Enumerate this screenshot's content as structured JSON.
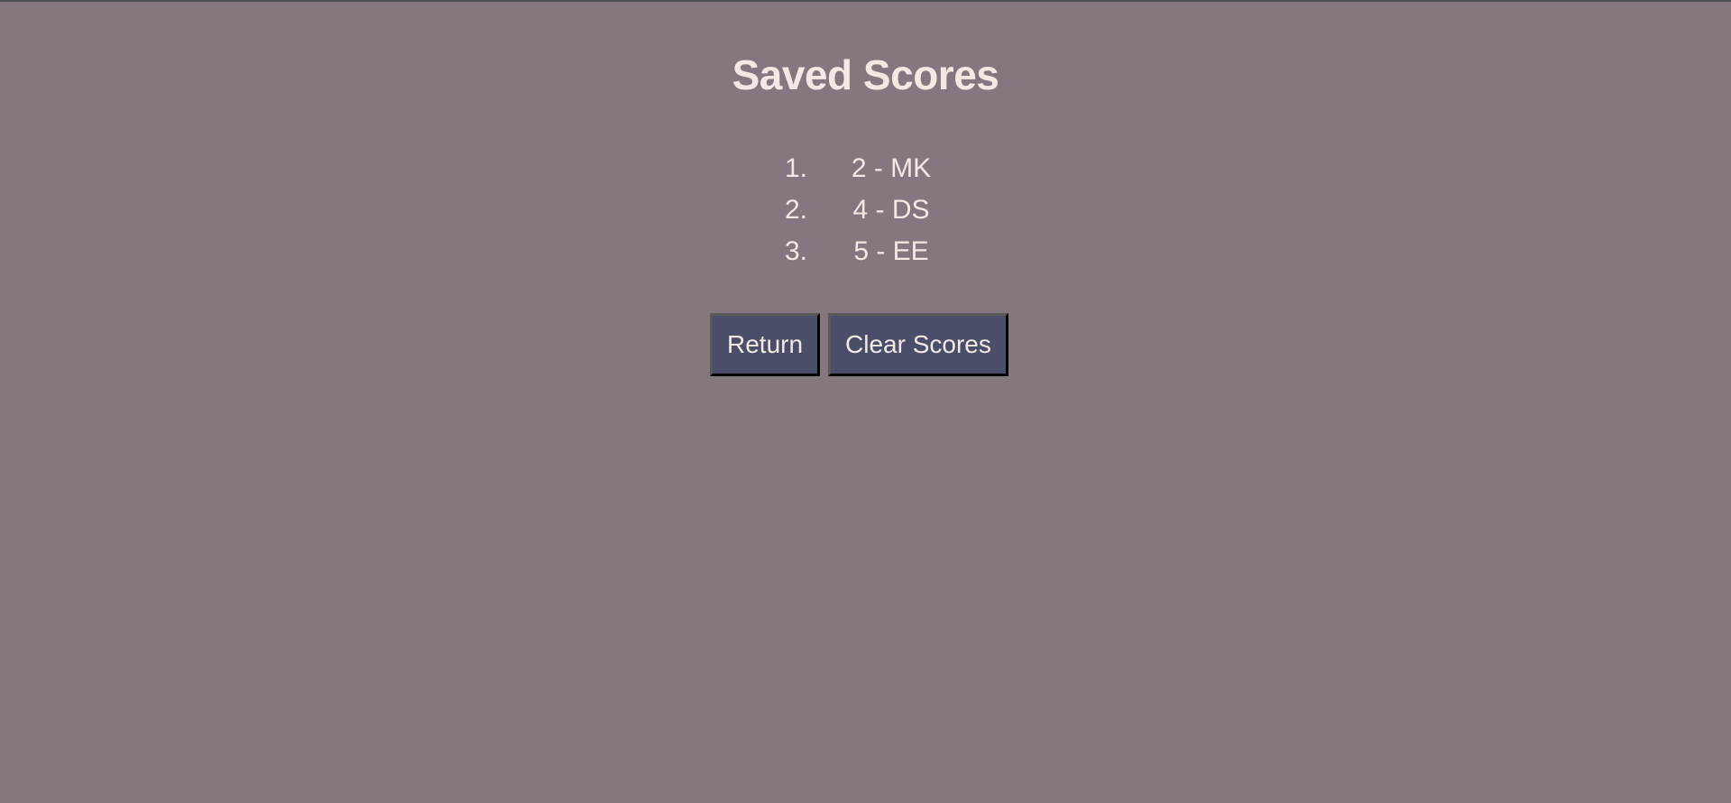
{
  "title": "Saved Scores",
  "scores": [
    {
      "rank": "1.",
      "entry": "2 - MK"
    },
    {
      "rank": "2.",
      "entry": "4 - DS"
    },
    {
      "rank": "3.",
      "entry": "5 - EE"
    }
  ],
  "buttons": {
    "return": "Return",
    "clear": "Clear Scores"
  },
  "colors": {
    "background": "#847780",
    "button": "#4a4e69",
    "text": "#f2e9e4"
  }
}
